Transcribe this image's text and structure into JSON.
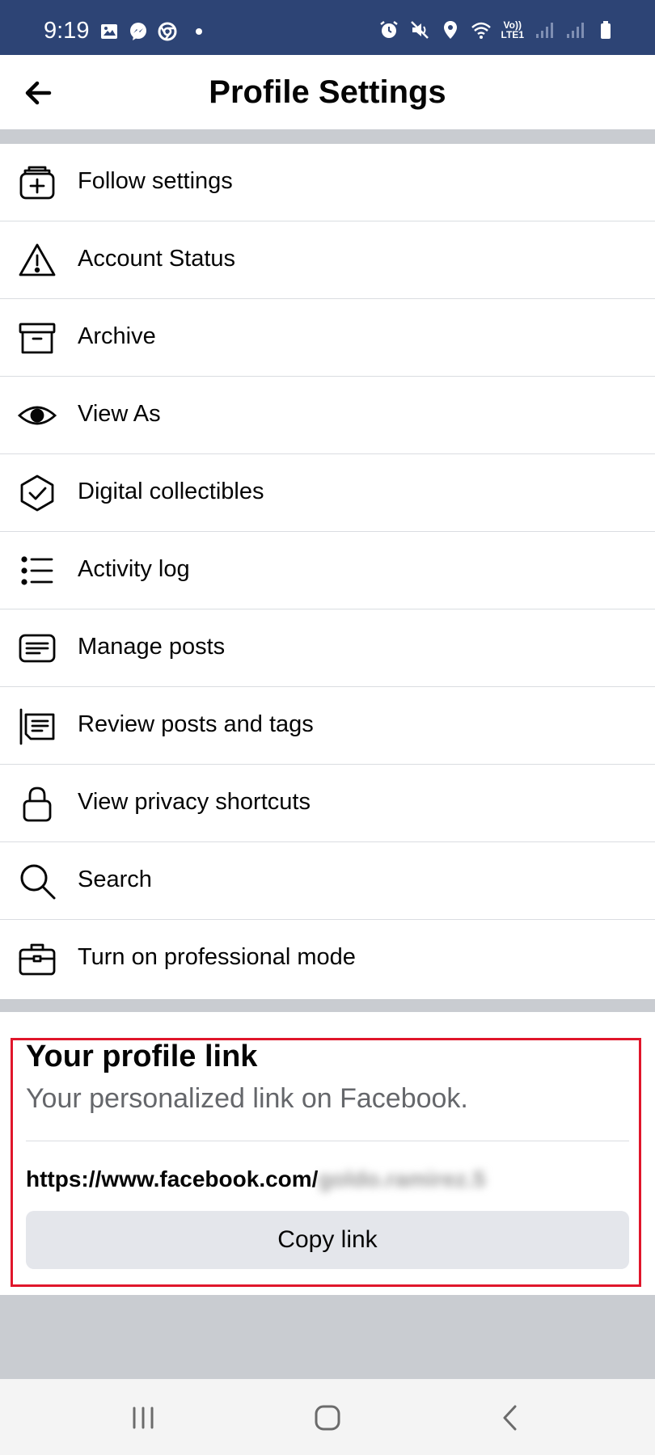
{
  "status_bar": {
    "time": "9:19",
    "left_icons": [
      "gallery-icon",
      "messenger-icon",
      "chrome-icon",
      "dot-icon"
    ],
    "right_icons": [
      "alarm-icon",
      "mute-icon",
      "location-icon",
      "wifi-icon",
      "volte-icon",
      "signal-icon",
      "signal-icon",
      "battery-icon"
    ],
    "volte_label_top": "Vo))",
    "volte_label_bottom": "LTE1"
  },
  "header": {
    "title": "Profile Settings",
    "back_icon": "arrow-left-icon"
  },
  "menu": {
    "items": [
      {
        "label": "Follow settings",
        "icon": "follow-settings-icon"
      },
      {
        "label": "Account Status",
        "icon": "warning-icon"
      },
      {
        "label": "Archive",
        "icon": "archive-icon"
      },
      {
        "label": "View As",
        "icon": "eye-icon"
      },
      {
        "label": "Digital collectibles",
        "icon": "shield-check-icon"
      },
      {
        "label": "Activity log",
        "icon": "list-icon"
      },
      {
        "label": "Manage posts",
        "icon": "posts-icon"
      },
      {
        "label": "Review posts and tags",
        "icon": "review-tags-icon"
      },
      {
        "label": "View privacy shortcuts",
        "icon": "lock-icon"
      },
      {
        "label": "Search",
        "icon": "search-icon"
      },
      {
        "label": "Turn on professional mode",
        "icon": "briefcase-icon"
      }
    ]
  },
  "profile_link": {
    "title": "Your profile link",
    "subtitle": "Your personalized link on Facebook.",
    "url_prefix": "https://www.facebook.com/",
    "url_suffix": "goldo.ramirez.5",
    "copy_label": "Copy link"
  },
  "nav_bar": {
    "icons": [
      "recent-apps-icon",
      "home-icon",
      "back-icon"
    ]
  },
  "colors": {
    "status_bar": "#2d4475",
    "band": "#c9ccd1",
    "highlight": "#e0162b",
    "button": "#e4e6eb"
  }
}
